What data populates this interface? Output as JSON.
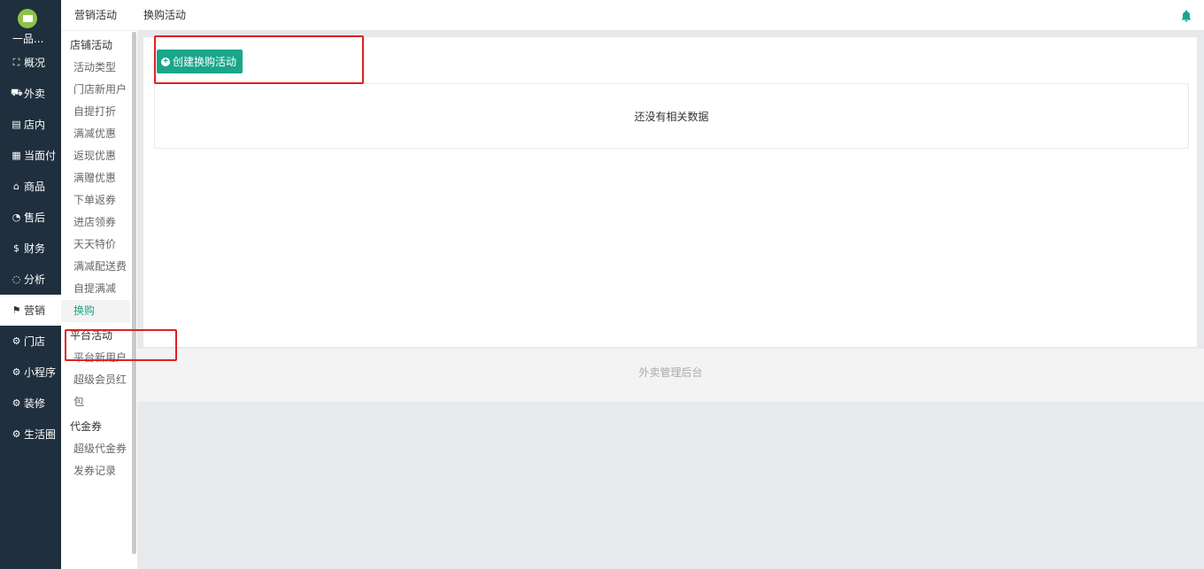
{
  "brand": {
    "name": "一品..."
  },
  "nav": [
    {
      "icon": "dashboard-icon",
      "glyph": "⛶",
      "label": "概况"
    },
    {
      "icon": "delivery-icon",
      "glyph": "⛟",
      "label": "外卖"
    },
    {
      "icon": "store-icon",
      "glyph": "▤",
      "label": "店内"
    },
    {
      "icon": "receipt-icon",
      "glyph": "▦",
      "label": "当面付"
    },
    {
      "icon": "bag-icon",
      "glyph": "⌂",
      "label": "商品"
    },
    {
      "icon": "aftersale-icon",
      "glyph": "◔",
      "label": "售后"
    },
    {
      "icon": "money-icon",
      "glyph": "$",
      "label": "财务"
    },
    {
      "icon": "chart-icon",
      "glyph": "◌",
      "label": "分析"
    },
    {
      "icon": "marketing-icon",
      "glyph": "⚑",
      "label": "营销"
    },
    {
      "icon": "gear-icon",
      "glyph": "⚙",
      "label": "门店"
    },
    {
      "icon": "gear-icon",
      "glyph": "⚙",
      "label": "小程序"
    },
    {
      "icon": "gear-icon",
      "glyph": "⚙",
      "label": "装修"
    },
    {
      "icon": "gear-icon",
      "glyph": "⚙",
      "label": "生活圈"
    }
  ],
  "sub": {
    "header": "营销活动",
    "groups": [
      {
        "title": "店铺活动",
        "links": [
          "活动类型",
          "门店新用户",
          "自提打折",
          "满减优惠",
          "返现优惠",
          "满赠优惠",
          "下单返券",
          "进店领券",
          "天天特价",
          "满减配送费",
          "自提满减",
          "换购"
        ]
      },
      {
        "title": "平台活动",
        "links": [
          "平台新用户",
          "超级会员红包"
        ]
      },
      {
        "title": "代金券",
        "links": [
          "超级代金券",
          "发券记录"
        ]
      }
    ]
  },
  "topbar": {
    "title": "换购活动"
  },
  "main": {
    "create_button": "创建换购活动",
    "empty_text": "还没有相关数据"
  },
  "footer": {
    "text": "外卖管理后台"
  },
  "colors": {
    "accent": "#1aa68a",
    "nav_bg": "#1f2f3d",
    "highlight": "#e02020"
  }
}
